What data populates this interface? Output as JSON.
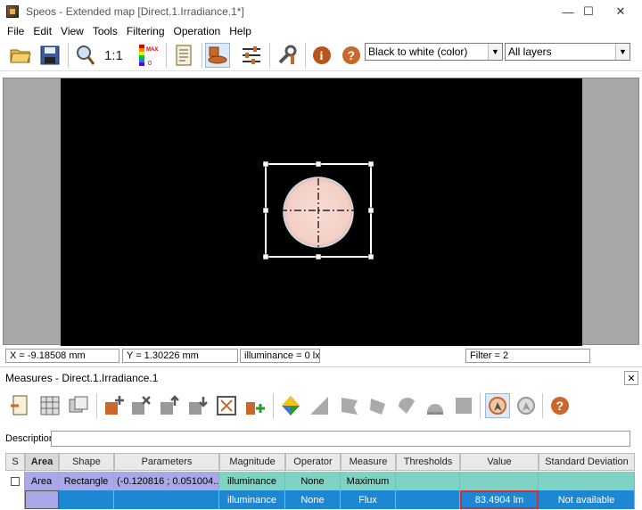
{
  "window": {
    "title": "Speos - Extended map [Direct.1.Irradiance.1*]",
    "minimize": "—",
    "maximize": "☐",
    "close": "✕"
  },
  "menu": [
    "File",
    "Edit",
    "View",
    "Tools",
    "Filtering",
    "Operation",
    "Help"
  ],
  "toolbar": {
    "color_mode": "Black to white (color)",
    "layers": "All layers"
  },
  "status": {
    "x": "X = -9.18508 mm",
    "y": "Y = 1.30226 mm",
    "illuminance": "illuminance = 0 lx",
    "filter": "Filter = 2"
  },
  "measures": {
    "title": "Measures - Direct.1.Irradiance.1",
    "close": "✕",
    "description_label": "Description:",
    "description_value": "",
    "columns": [
      "S",
      "Area",
      "Shape",
      "Parameters",
      "Magnitude",
      "Operator",
      "Measure",
      "Thresholds",
      "Value",
      "Standard Deviation"
    ],
    "rows": [
      {
        "area": "Area",
        "shape": "Rectangle",
        "parameters": "(-0.120816 ; 0.051004...",
        "magnitude": "illuminance",
        "operator": "None",
        "measure": "Maximum",
        "thresholds": "",
        "value": "",
        "std_dev": ""
      },
      {
        "area": "",
        "shape": "",
        "parameters": "",
        "magnitude": "illuminance",
        "operator": "None",
        "measure": "Flux",
        "thresholds": "",
        "value": "83.4904 lm",
        "std_dev": "Not available"
      }
    ]
  },
  "colors": {
    "accent_selection": "#1d87d4",
    "spot_fill": "#f6d4cc",
    "value_highlight": "#d03030"
  }
}
